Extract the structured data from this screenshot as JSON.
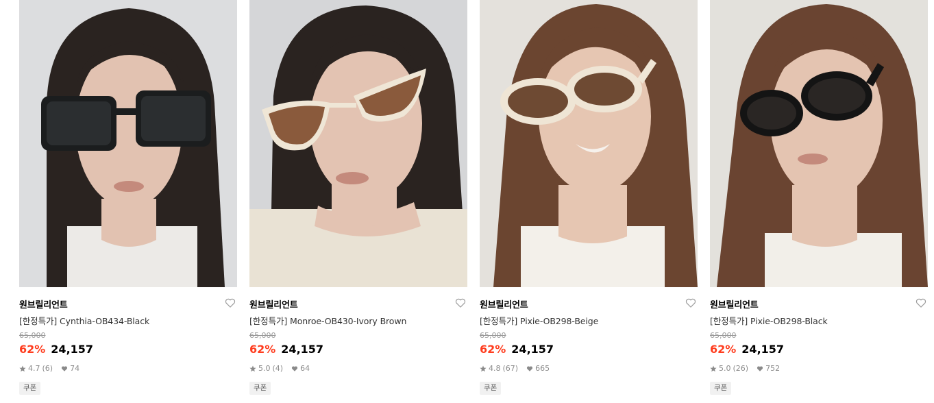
{
  "products": [
    {
      "brand": "원브릴리언트",
      "name": "[한정특가] Cynthia-OB434-Black",
      "original_price": "65,000",
      "discount": "62%",
      "price": "24,157",
      "rating": "4.7",
      "reviews": "(6)",
      "likes": "74",
      "badge": "쿠폰",
      "image_alt": "model wearing black square sunglasses",
      "colors": {
        "bg": "#dcdddf",
        "hair": "#2a2320",
        "skin": "#e2c2b1",
        "shirt": "#eceae7",
        "lens": "#2b2e30",
        "frame": "#1b1d1e"
      }
    },
    {
      "brand": "원브릴리언트",
      "name": "[한정특가] Monroe-OB430-Ivory Brown",
      "original_price": "65,000",
      "discount": "62%",
      "price": "24,157",
      "rating": "5.0",
      "reviews": "(4)",
      "likes": "64",
      "badge": "쿠폰",
      "image_alt": "model wearing ivory cat-eye sunglasses with brown lenses",
      "colors": {
        "bg": "#d5d6d8",
        "hair": "#2a2320",
        "skin": "#e3c3b2",
        "shirt": "#e9e2d4",
        "lens": "#8a5a3c",
        "frame": "#efe6d6"
      }
    },
    {
      "brand": "원브릴리언트",
      "name": "[한정특가] Pixie-OB298-Beige",
      "original_price": "65,000",
      "discount": "62%",
      "price": "24,157",
      "rating": "4.8",
      "reviews": "(67)",
      "likes": "665",
      "badge": "쿠폰",
      "image_alt": "smiling model wearing beige oval sunglasses",
      "colors": {
        "bg": "#e4e1dc",
        "hair": "#6b4530",
        "skin": "#e6c6b2",
        "shirt": "#f3f0ea",
        "lens": "#6e4a33",
        "frame": "#efe5d5"
      }
    },
    {
      "brand": "원브릴리언트",
      "name": "[한정특가] Pixie-OB298-Black",
      "original_price": "65,000",
      "discount": "62%",
      "price": "24,157",
      "rating": "5.0",
      "reviews": "(26)",
      "likes": "752",
      "badge": "쿠폰",
      "image_alt": "model wearing black oval sunglasses",
      "colors": {
        "bg": "#e3e1dc",
        "hair": "#6a4431",
        "skin": "#e4c4b1",
        "shirt": "#f2efe9",
        "lens": "#2a2624",
        "frame": "#141414"
      }
    }
  ],
  "icons": {
    "like": "heart-outline-icon",
    "rating": "star-icon",
    "likes_count": "heart-filled-icon"
  }
}
